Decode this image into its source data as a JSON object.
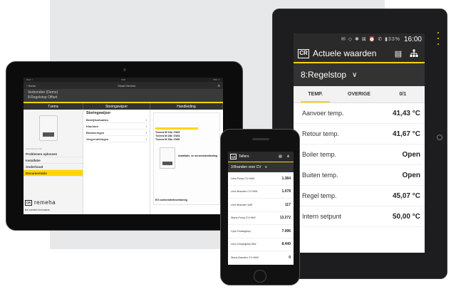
{
  "android_tablet": {
    "status_bar": {
      "system_icons": "✉ ◇ ✱ ⊠ ⏰ ✆ ▮33%",
      "time": "16:00"
    },
    "app_bar": {
      "logo": "CR",
      "title": "Actuele waarden",
      "doc_icon": "document-icon",
      "tree_icon": "hierarchy-icon"
    },
    "selector": {
      "label": "8:Regelstop",
      "chevron": "chevron-down-icon"
    },
    "tabs": [
      {
        "label": "TEMP.",
        "active": true
      },
      {
        "label": "OVERIGE",
        "active": false
      },
      {
        "label": "0/1",
        "active": false
      }
    ],
    "rows": [
      {
        "label": "Aanvoer temp.",
        "value": "41,43 °C"
      },
      {
        "label": "Retour temp.",
        "value": "41,67 °C"
      },
      {
        "label": "Boiler temp.",
        "value": "Open"
      },
      {
        "label": "Buiten temp.",
        "value": "Open"
      },
      {
        "label": "Regel temp.",
        "value": "45,07 °C"
      },
      {
        "label": "Intern setpunt",
        "value": "50,00 °C"
      }
    ]
  },
  "ipad": {
    "status": {
      "left": "iPad ⌔",
      "center": "9:08",
      "right": "65% ▭"
    },
    "nav": {
      "back": "‹ Home",
      "title": "Smart Service",
      "gear": "gear-icon"
    },
    "header": {
      "line1": "Verbonden (Demo)",
      "line2": "8:Regelstop   Offset"
    },
    "tabs": {
      "device": "Tzerra",
      "faults": "Storingswijzer",
      "manual": "Handleiding"
    },
    "menu": {
      "group_label": "Gebruikersprofiel",
      "items": [
        {
          "label": "Problemen oplossen",
          "selected": false
        },
        {
          "label": "Installatie",
          "selected": false
        },
        {
          "label": "Onderhoud",
          "selected": false
        },
        {
          "label": "Documentatie",
          "selected": true
        }
      ]
    },
    "brand": {
      "logo": "CR",
      "name": "remeha",
      "tagline": "the comfort innovators"
    },
    "faults": {
      "heading": "Storingswijzer",
      "items": [
        "Bedrijfssituaties",
        "Klachten",
        "Blokkeringen",
        "Vergrendelingen"
      ]
    },
    "manual": {
      "models": [
        "Tzerra M 24c CW3",
        "Tzerra M 28c CW4",
        "Tzerra M 39c CW5"
      ],
      "caption": "Installatie- en servicehandleiding",
      "footer": "EG conformiteitsverklaring"
    }
  },
  "iphone": {
    "app_bar": {
      "logo": "CR",
      "title": "Tellers"
    },
    "selector": "3:Branden voor CV",
    "rows": [
      {
        "label": "Uren Pomp CV+WW",
        "value": "1.384"
      },
      {
        "label": "Uren Branden CV+WW",
        "value": "1.078"
      },
      {
        "label": "Uren Branden WW",
        "value": "117"
      },
      {
        "label": "Starts Pomp CV+WW",
        "value": "13.272"
      },
      {
        "label": "Cycli Omwegklep",
        "value": "7.096"
      },
      {
        "label": "Uren Omwegklep WW",
        "value": "8.440"
      },
      {
        "label": "Starts Branden CV+WW",
        "value": "0"
      }
    ]
  },
  "colors": {
    "accent": "#ffd500",
    "dark": "#2a2a2a",
    "background_panel": "#e7e8ea"
  }
}
